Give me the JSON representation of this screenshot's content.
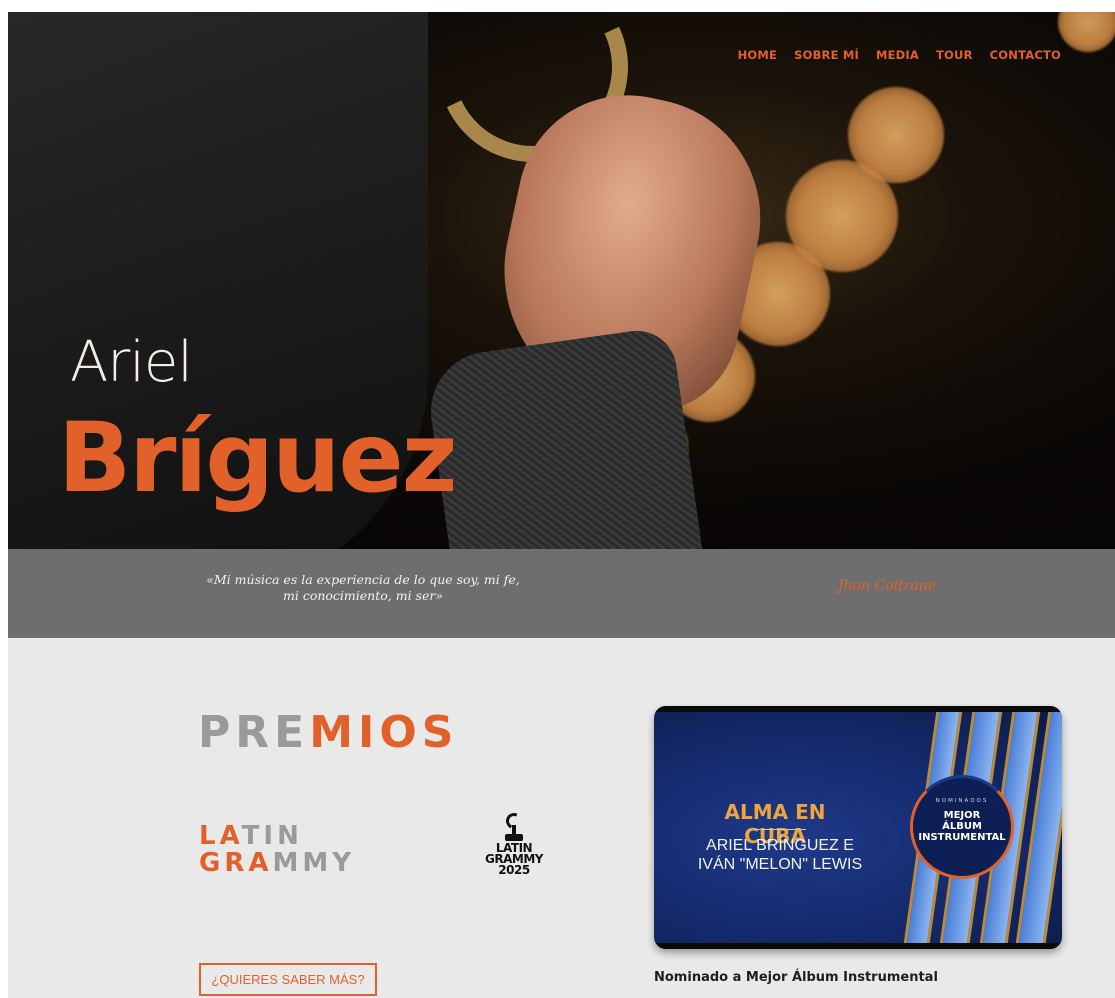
{
  "nav": {
    "items": [
      "HOME",
      "SOBRE MÍ",
      "MEDIA",
      "TOUR",
      "CONTACTO"
    ]
  },
  "hero": {
    "first_name": "Ariel",
    "last_name": "Bríguez"
  },
  "quote": {
    "text": "«Mi música es la experiencia de lo que soy, mi fe, mi conocimiento, mi ser»",
    "author": "Jhon Coltrane"
  },
  "awards": {
    "title_gray": "PRE",
    "title_orange": "MIOS",
    "latin_grammy": {
      "line1_orange": "LA",
      "line1_gray": "TIN",
      "line2_orange": "GRA",
      "line2_gray": "MMY"
    },
    "grammy_logo": {
      "line1": "LATIN",
      "line2": "GRAMMY",
      "line3": "2025"
    },
    "more_button": "¿QUIERES SABER MÁS?",
    "album_card": {
      "album_title": "ALMA EN CUBA",
      "artists_line1": "ARIEL BRÍNGUEZ E",
      "artists_line2": "IVÁN \"MELON\" LEWIS",
      "nominados": "NOMINADOS",
      "category_line1": "MEJOR",
      "category_line2": "ÁLBUM",
      "category_line3": "INSTRUMENTAL"
    },
    "caption": "Nominado a Mejor Álbum Instrumental"
  },
  "colors": {
    "accent": "#e2612a",
    "gray_text": "#9a9a9a",
    "quote_band": "#6e6e6e",
    "section_bg": "#e9e9e9"
  }
}
